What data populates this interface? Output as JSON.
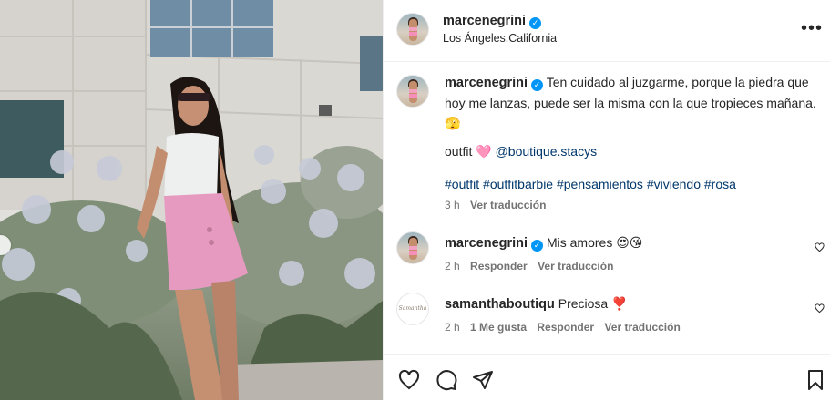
{
  "post": {
    "username": "marcenegrini",
    "location": "Los Ángeles,California",
    "caption": "Ten cuidado al juzgarme, porque la piedra que hoy me lanzas, puede ser la misma con la que tropieces mañana.",
    "caption_emoji": "🫣",
    "outfit_label": "outfit",
    "outfit_emoji": "🩷",
    "outfit_mention": "@boutique.stacys",
    "hashtags": [
      "#outfit",
      "#outfitbarbie",
      "#pensamientos",
      "#viviendo",
      "#rosa"
    ],
    "time": "3 h",
    "see_translation": "Ver traducción"
  },
  "comments": [
    {
      "username": "marcenegrini",
      "verified": true,
      "text": "Mis amores 😍😘",
      "time": "2 h",
      "reply": "Responder",
      "translate": "Ver traducción"
    },
    {
      "username": "samanthaboutiqu",
      "verified": false,
      "text": "Preciosa ❣️",
      "time": "2 h",
      "likes": "1 Me gusta",
      "reply": "Responder",
      "translate": "Ver traducción",
      "avatar_text": "Samantha"
    }
  ],
  "icons": {
    "more": "more-options-icon",
    "like": "heart-icon",
    "comment": "comment-icon",
    "share": "share-icon",
    "save": "bookmark-icon",
    "verified": "verified-badge-icon"
  },
  "colors": {
    "verified": "#0095f6",
    "link": "#00376b",
    "meta": "#737373"
  }
}
